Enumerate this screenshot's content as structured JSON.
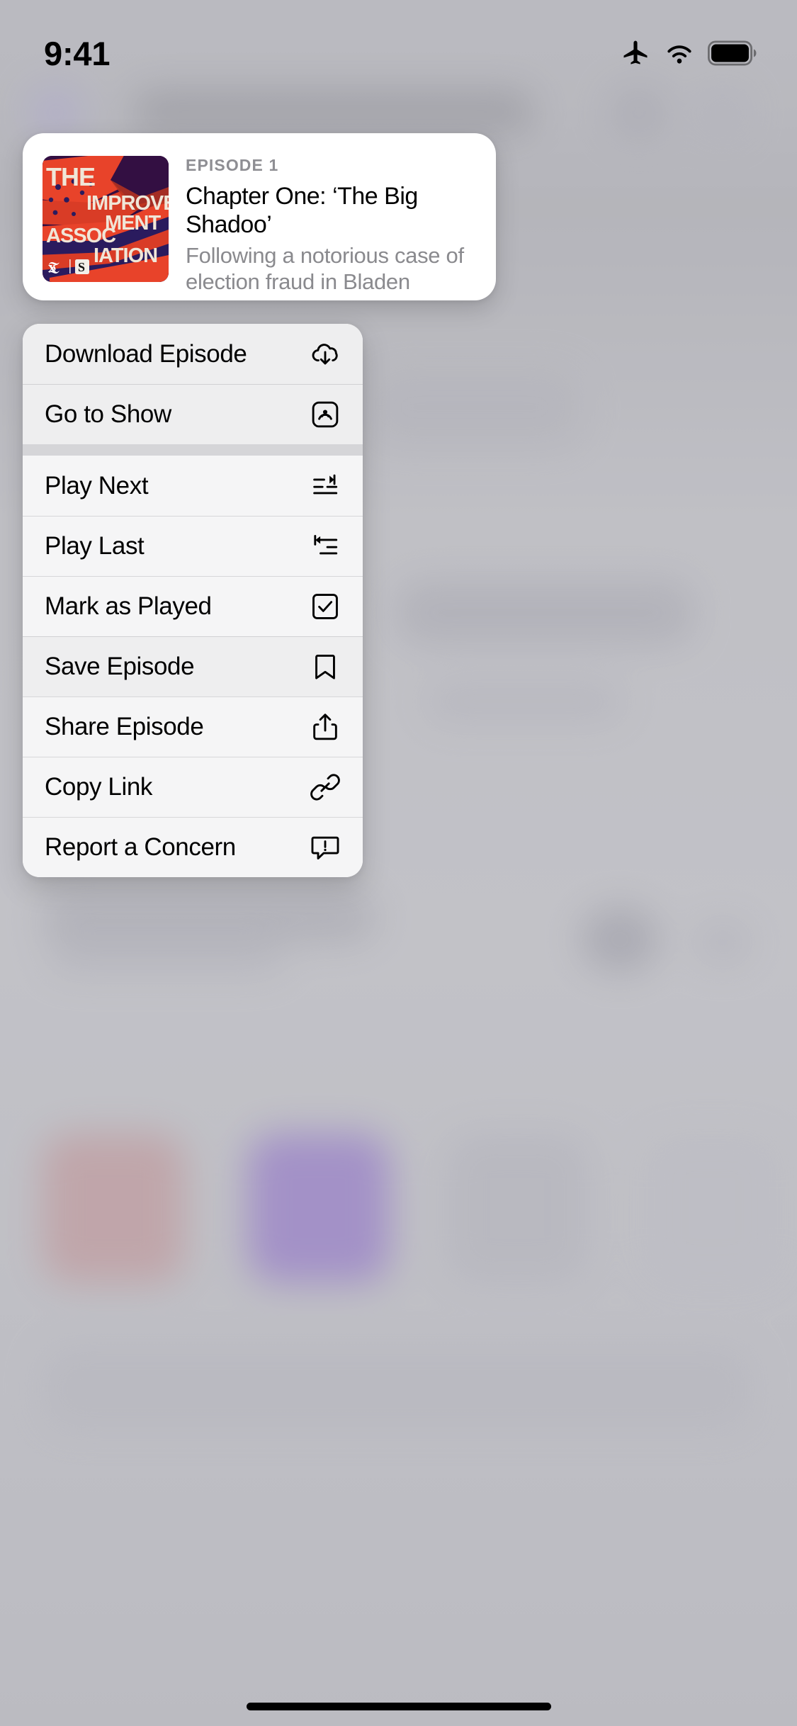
{
  "status_bar": {
    "time": "9:41",
    "icons": [
      "airplane-mode-icon",
      "wifi-icon",
      "battery-icon"
    ]
  },
  "preview_card": {
    "artwork": {
      "name": "podcast-artwork",
      "title_lines": [
        "THE",
        "IMPROVE",
        "MENT",
        "ASSOC",
        "IATION"
      ],
      "publisher_marks": [
        "nyt-t-logo",
        "serial-s-logo"
      ],
      "colors": {
        "background": "#2d0d3a",
        "flag_red": "#e8432a",
        "flag_navy": "#2a1b5e",
        "type_cream": "#f0e6d8"
      }
    },
    "kicker": "EPISODE 1",
    "title": "Chapter One: ‘The Big Shadoo’",
    "description": "Following a notorious case of election fraud in Bladen County…"
  },
  "context_menu": {
    "groups": [
      {
        "items": [
          {
            "label": "Download Episode",
            "icon": "download-cloud-icon"
          },
          {
            "label": "Go to Show",
            "icon": "podcast-show-icon"
          }
        ]
      },
      {
        "items": [
          {
            "label": "Play Next",
            "icon": "play-next-icon"
          },
          {
            "label": "Play Last",
            "icon": "play-last-icon"
          },
          {
            "label": "Mark as Played",
            "icon": "checkmark-box-icon"
          },
          {
            "label": "Save Episode",
            "icon": "bookmark-icon"
          },
          {
            "label": "Share Episode",
            "icon": "share-icon"
          },
          {
            "label": "Copy Link",
            "icon": "link-icon"
          },
          {
            "label": "Report a Concern",
            "icon": "report-concern-icon"
          }
        ]
      }
    ]
  },
  "home_indicator": {
    "name": "home-indicator"
  }
}
